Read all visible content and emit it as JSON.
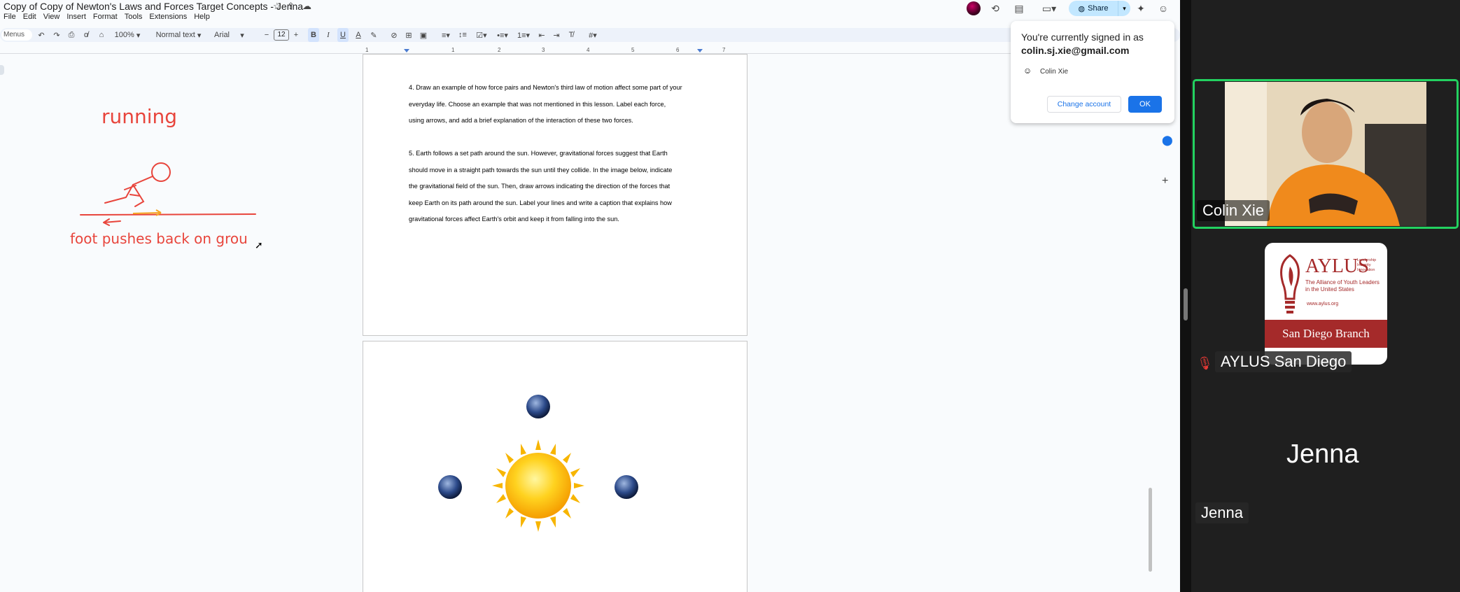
{
  "docs": {
    "title": "Copy of Copy of Newton's Laws and Forces Target Concepts - Jenna",
    "menu": [
      "File",
      "Edit",
      "View",
      "Insert",
      "Format",
      "Tools",
      "Extensions",
      "Help"
    ],
    "share_label": "Share",
    "toolbar": {
      "menus_placeholder": "Menus",
      "zoom": "100%",
      "style": "Normal text",
      "font": "Arial",
      "font_size": "12"
    },
    "ruler_numbers": [
      "1",
      "1",
      "2",
      "3",
      "4",
      "5",
      "6",
      "7"
    ],
    "drawing": {
      "label_top": "running",
      "label_bottom": "foot pushes back on grou"
    },
    "questions": {
      "q4": [
        "4. Draw an example of how force pairs and Newton's third law of motion affect some part of your",
        "everyday life. Choose an example that was not mentioned in this lesson. Label each force,",
        "using arrows, and add a brief explanation of the interaction of these two forces."
      ],
      "q5": [
        "5. Earth follows a set path around the sun. However, gravitational forces suggest that Earth",
        "should move in a straight path towards the sun until they collide. In the image below, indicate",
        "the gravitational field of the sun. Then, draw arrows indicating the direction of the forces that",
        "keep Earth on its path around the sun. Label your lines and write a caption that explains how",
        "gravitational forces affect Earth's orbit and keep it from falling into the sun."
      ]
    },
    "popup": {
      "title": "You're currently signed in as",
      "email": "colin.sj.xie@gmail.com",
      "user": "Colin Xie",
      "change_label": "Change account",
      "ok_label": "OK"
    }
  },
  "meeting": {
    "participants": [
      {
        "name": "Colin Xie",
        "speaking": true
      },
      {
        "name": "AYLUS San Diego",
        "muted": true
      },
      {
        "name": "Jenna",
        "initials_display": "Jenna"
      }
    ],
    "aylus_logo": {
      "big": "AYLUS",
      "tag": [
        "Leadership",
        "Integrity",
        "Innovation"
      ],
      "small": [
        "The Alliance of Youth Leaders",
        "in the United States"
      ],
      "url": "www.aylus.org",
      "band": "San Diego Branch"
    }
  },
  "colors": {
    "accent": "#1a73e8",
    "speaking": "#23d160",
    "aylus": "#a52a2a",
    "ink": "#e8453c"
  }
}
